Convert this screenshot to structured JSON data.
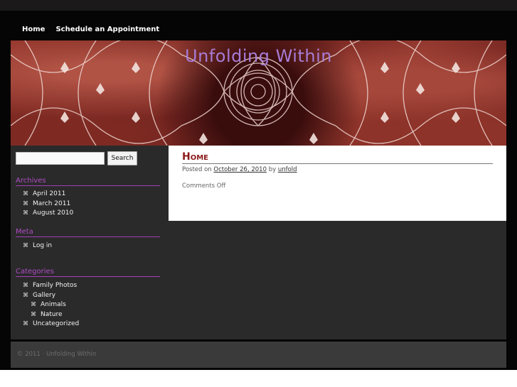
{
  "nav": {
    "items": [
      {
        "label": "Home"
      },
      {
        "label": "Schedule an Appointment"
      }
    ]
  },
  "header": {
    "title": "Unfolding Within"
  },
  "search": {
    "placeholder": "",
    "value": "",
    "button_label": "Search"
  },
  "sidebar": {
    "archives": {
      "title": "Archives",
      "items": [
        "April 2011",
        "March 2011",
        "August 2010"
      ]
    },
    "meta": {
      "title": "Meta",
      "items": [
        "Log in"
      ]
    },
    "categories": {
      "title": "Categories",
      "items": [
        {
          "label": "Family Photos",
          "level": 0
        },
        {
          "label": "Gallery",
          "level": 0
        },
        {
          "label": "Animals",
          "level": 1
        },
        {
          "label": "Nature",
          "level": 1
        },
        {
          "label": "Uncategorized",
          "level": 0
        }
      ]
    },
    "bullet_glyph": "⌘"
  },
  "post": {
    "title": "Home",
    "meta_prefix": "Posted on",
    "date": "October 26, 2010",
    "by": "by",
    "author": "unfold",
    "comments": "Comments Off"
  },
  "footer": {
    "text": "© 2011 · Unfolding Within"
  },
  "colors": {
    "accent_purple": "#b04cc6",
    "title_purple": "#a87bd6",
    "post_title_red": "#8b1a1a",
    "page_bg": "#050505",
    "panel_bg": "#2a2a2a"
  }
}
